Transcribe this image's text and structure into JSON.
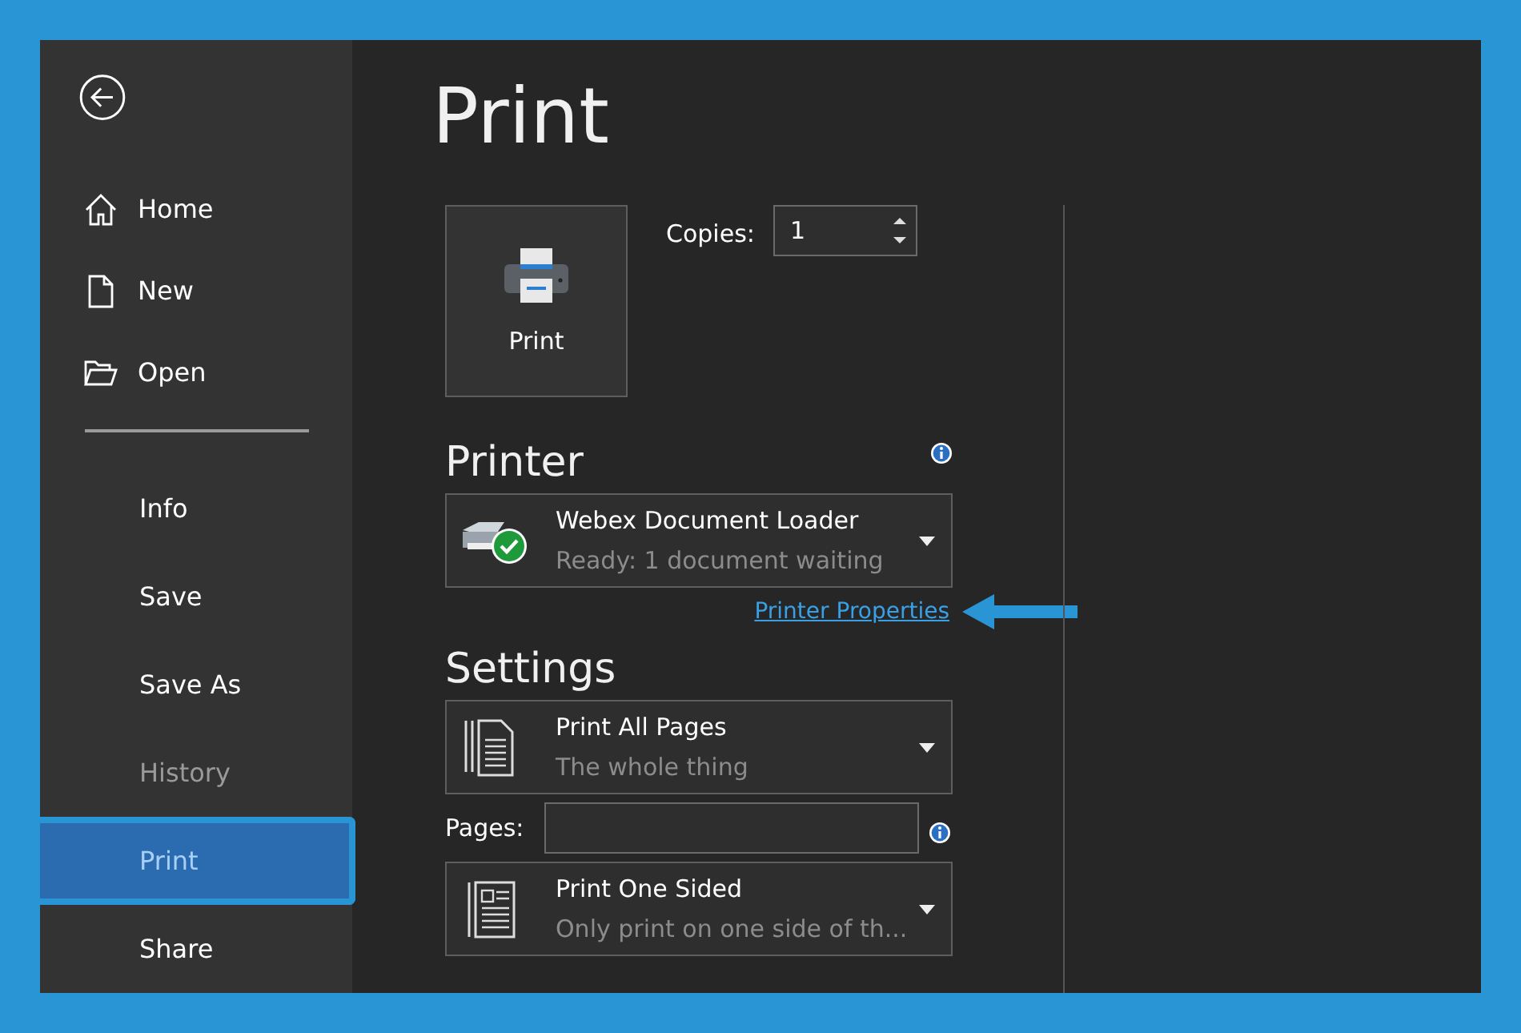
{
  "sidebar": {
    "top_items": [
      {
        "label": "Home",
        "kind": "home"
      },
      {
        "label": "New",
        "kind": "new"
      },
      {
        "label": "Open",
        "kind": "open"
      }
    ],
    "items": [
      {
        "label": "Info",
        "selected": false,
        "disabled": false
      },
      {
        "label": "Save",
        "selected": false,
        "disabled": false
      },
      {
        "label": "Save As",
        "selected": false,
        "disabled": false
      },
      {
        "label": "History",
        "selected": false,
        "disabled": true
      },
      {
        "label": "Print",
        "selected": true,
        "disabled": false
      },
      {
        "label": "Share",
        "selected": false,
        "disabled": false
      }
    ]
  },
  "title": "Print",
  "print_button": "Print",
  "copies": {
    "label": "Copies:",
    "value": "1"
  },
  "printer": {
    "heading": "Printer",
    "name": "Webex Document Loader",
    "status": "Ready: 1 document waiting",
    "properties_link": "Printer Properties"
  },
  "settings": {
    "heading": "Settings",
    "items": [
      {
        "kind": "dropdown",
        "title": "Print All Pages",
        "subtitle": "The whole thing"
      },
      {
        "kind": "field",
        "label": "Pages:"
      },
      {
        "kind": "dropdown",
        "title": "Print One Sided",
        "subtitle": "Only print on one side of th..."
      }
    ]
  }
}
